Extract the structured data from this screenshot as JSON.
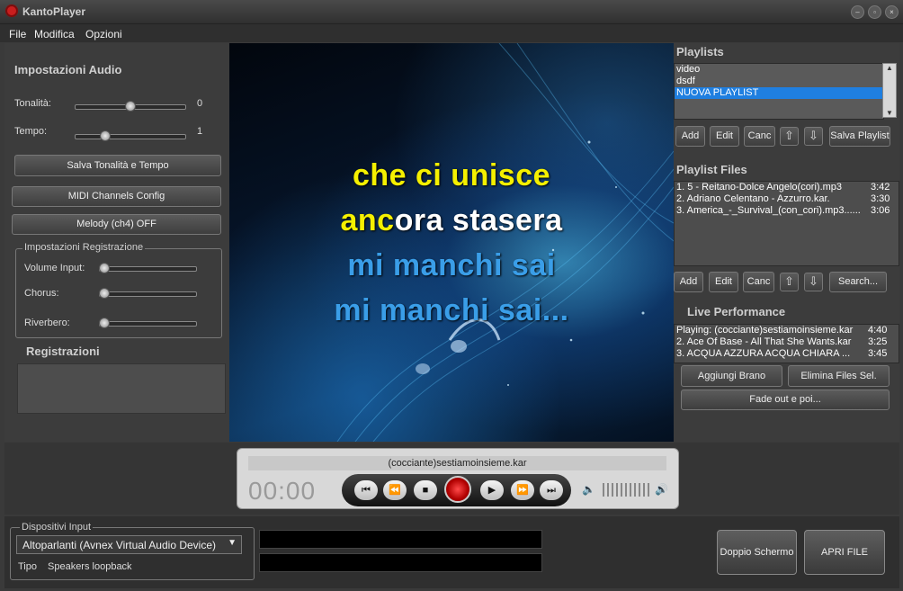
{
  "window": {
    "title": "KantoPlayer",
    "controls": [
      "minimize-icon",
      "restore-icon",
      "close-icon"
    ]
  },
  "menu": {
    "items": [
      "File",
      "Modifica",
      "Opzioni"
    ]
  },
  "audio_settings": {
    "title": "Impostazioni Audio",
    "pitch_label": "Tonalità:",
    "pitch_value": "0",
    "tempo_label": "Tempo:",
    "tempo_value": "1",
    "save_button": "Salva Tonalità e Tempo",
    "midi_button": "MIDI Channels Config",
    "melody_button": "Melody (ch4) OFF"
  },
  "recording_settings": {
    "legend": "Impostazioni Registrazione",
    "volume_label": "Volume Input:",
    "chorus_label": "Chorus:",
    "reverb_label": "Riverbero:"
  },
  "recordings": {
    "title": "Registrazioni"
  },
  "lyrics": {
    "line1": "che ci unisce",
    "line2_sung": "anc",
    "line2_rest": "ora stasera",
    "line3": "mi manchi sai",
    "line4": "mi manchi sai...",
    "colors": {
      "sung": "#f5f000",
      "current": "#ffffff",
      "next": "#3a9ee8"
    }
  },
  "playlists": {
    "title": "Playlists",
    "items": [
      {
        "label": "video",
        "selected": false
      },
      {
        "label": "dsdf",
        "selected": false
      },
      {
        "label": "NUOVA PLAYLIST",
        "selected": true
      }
    ],
    "buttons": {
      "add": "Add",
      "edit": "Edit",
      "delete": "Canc",
      "save": "Salva Playlist"
    }
  },
  "playlist_files": {
    "title": "Playlist Files",
    "items": [
      {
        "name": "1. 5 - Reitano-Dolce Angelo(cori).mp3",
        "duration": "3:42"
      },
      {
        "name": "2. Adriano Celentano - Azzurro.kar.",
        "duration": "3:30"
      },
      {
        "name": "3. America_-_Survival_(con_cori).mp3......",
        "duration": "3:06"
      }
    ],
    "buttons": {
      "add": "Add",
      "edit": "Edit",
      "delete": "Canc",
      "search": "Search..."
    }
  },
  "live": {
    "title": "Live Performance",
    "items": [
      {
        "name": "Playing: (cocciante)sestiamoinsieme.kar",
        "duration": "4:40"
      },
      {
        "name": "2. Ace Of Base - All That She Wants.kar",
        "duration": "3:25"
      },
      {
        "name": "3. ACQUA AZZURA ACQUA CHIARA  ...",
        "duration": "3:45"
      }
    ],
    "add_button": "Aggiungi Brano",
    "remove_button": "Elimina Files Sel.",
    "fade_button": "Fade out e poi..."
  },
  "player": {
    "track": "(cocciante)sestiamoinsieme.kar",
    "time": "00:00",
    "transport_icons": [
      "skip-back-icon",
      "rewind-icon",
      "stop-icon",
      "record-icon",
      "play-icon",
      "fast-forward-icon",
      "skip-forward-icon"
    ]
  },
  "input_devices": {
    "legend": "Dispositivi Input",
    "selected_device": "Altoparlanti (Avnex Virtual Audio Device)",
    "type_label": "Tipo",
    "type_value": "Speakers loopback"
  },
  "actions": {
    "dual_screen": "Doppio Schermo",
    "open_file": "APRI FILE"
  }
}
